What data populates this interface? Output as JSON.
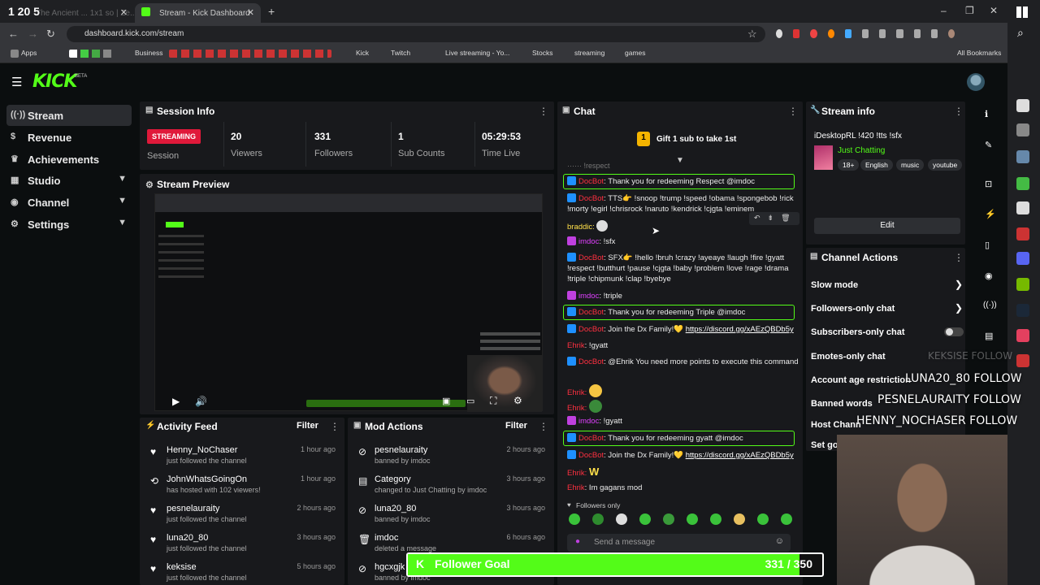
{
  "browser": {
    "tab1_title": "The Ancient ... 1x1 so | Ze...",
    "tab1_badges": "1 20 5",
    "tab2_title": "Stream - Kick Dashboard",
    "url": "dashboard.kick.com/stream",
    "bookmarks": [
      "Apps",
      "Business",
      "Kick",
      "Twitch",
      "Live streaming - Yo...",
      "Stocks",
      "streaming",
      "games"
    ],
    "all_bookmarks": "All Bookmarks"
  },
  "sidebar": {
    "items": [
      {
        "label": "Stream",
        "icon": "stream-icon"
      },
      {
        "label": "Revenue",
        "icon": "dollar-icon"
      },
      {
        "label": "Achievements",
        "icon": "trophy-icon"
      },
      {
        "label": "Studio",
        "icon": "grid-icon"
      },
      {
        "label": "Channel",
        "icon": "broadcast-icon"
      },
      {
        "label": "Settings",
        "icon": "gear-icon"
      }
    ]
  },
  "logo": "KICK",
  "logo_beta": "BETA",
  "session": {
    "title": "Session Info",
    "status": "STREAMING",
    "status_label": "Session",
    "viewers": "20",
    "viewers_label": "Viewers",
    "followers": "331",
    "followers_label": "Followers",
    "subs": "1",
    "subs_label": "Sub Counts",
    "time": "05:29:53",
    "time_label": "Time Live"
  },
  "preview": {
    "title": "Stream Preview"
  },
  "activity": {
    "title": "Activity Feed",
    "filter": "Filter",
    "rows": [
      {
        "name": "Henny_NoChaser",
        "sub": "just followed the channel",
        "time": "1 hour ago"
      },
      {
        "name": "JohnWhatsGoingOn",
        "sub": "has hosted with 102 viewers!",
        "time": "1 hour ago"
      },
      {
        "name": "pesnelauraity",
        "sub": "just followed the channel",
        "time": "2 hours ago"
      },
      {
        "name": "luna20_80",
        "sub": "just followed the channel",
        "time": "3 hours ago"
      },
      {
        "name": "keksise",
        "sub": "just followed the channel",
        "time": "5 hours ago"
      }
    ]
  },
  "mod": {
    "title": "Mod Actions",
    "filter": "Filter",
    "rows": [
      {
        "name": "pesnelauraity",
        "sub": "banned by imdoc",
        "time": "2 hours ago"
      },
      {
        "name": "Category",
        "sub": "changed to Just Chatting by imdoc",
        "time": "3 hours ago"
      },
      {
        "name": "luna20_80",
        "sub": "banned by imdoc",
        "time": "3 hours ago"
      },
      {
        "name": "imdoc",
        "sub": "deleted a message",
        "time": "6 hours ago"
      },
      {
        "name": "hgcxgjk",
        "sub": "banned by imdoc",
        "time": ""
      }
    ]
  },
  "chat": {
    "title": "Chat",
    "gift": "Gift 1 sub to take 1st",
    "l1_name": "DocBot",
    "l1_text": ": Thank you for redeeming Respect @imdoc",
    "l2_name": "DocBot",
    "l2_text": ": TTS👉 !snoop !trump !speed !obama !spongebob !rick !morty !egirl !chrisrock !naruto !kendrick !cjgta !eminem",
    "l3_name": "braddic:",
    "l4_name": "imdoc",
    "l4_text": ": !sfx",
    "l5_name": "DocBot",
    "l5_text": ": SFX👉 !hello !bruh !crazy !ayeaye !laugh !fire !gyatt !respect !butthurt !pause !cjgta !baby !problem !love !rage !drama !triple !chipmunk !clap !byebye",
    "l6_name": "imdoc",
    "l6_text": ": !triple",
    "l7_name": "DocBot",
    "l7_text": ": Thank you for redeeming Triple @imdoc",
    "l8_name": "DocBot",
    "l8_text": ": Join the Dx Family!💛 ",
    "l8_link": "https://discord.gg/xAEzQBDb5y",
    "l9_name": "Ehrik",
    "l9_text": ": !gyatt",
    "l10_name": "DocBot",
    "l10_text": ": @Ehrik You need more points to execute this command",
    "l11_name": "Ehrik:",
    "l12_name": "Ehrik:",
    "l13_name": "imdoc",
    "l13_text": ": !gyatt",
    "l14_name": "DocBot",
    "l14_text": ": Thank you for redeeming gyatt @imdoc",
    "l15_name": "DocBot",
    "l15_text": ": Join the Dx Family!💛 ",
    "l15_link": "https://discord.gg/xAEzQBDb5y",
    "l16_name": "Ehrik:",
    "l16_text": "W",
    "l17_name": "Ehrik",
    "l17_text": ": Im gagans mod",
    "followers_only": "Followers only",
    "placeholder": "Send a message"
  },
  "streaminfo": {
    "title": "Stream info",
    "stream_title": "iDesktopRL !420 !tts !sfx",
    "category": "Just Chatting",
    "tags": [
      "18+",
      "English",
      "music",
      "youtube"
    ],
    "edit": "Edit"
  },
  "channel_actions": {
    "title": "Channel Actions",
    "items": [
      "Slow mode",
      "Followers-only chat",
      "Subscribers-only chat",
      "Emotes-only chat",
      "Account age restriction",
      "Banned words",
      "Host Chann",
      "Set goa"
    ]
  },
  "overlay": {
    "keksise": "KEKSISE FOLLOW",
    "luna": "LUNA20_80 FOLLOW",
    "pesne": "PESNELAURAITY FOLLOW",
    "henny": "HENNY_NOCHASER FOLLOW",
    "goal_label": "Follower Goal",
    "goal_value": "331 / 350",
    "goal_current": 331,
    "goal_target": 350
  },
  "colors": {
    "accent": "#53fc18",
    "streaming": "#e0193a",
    "panel": "#18191c"
  }
}
